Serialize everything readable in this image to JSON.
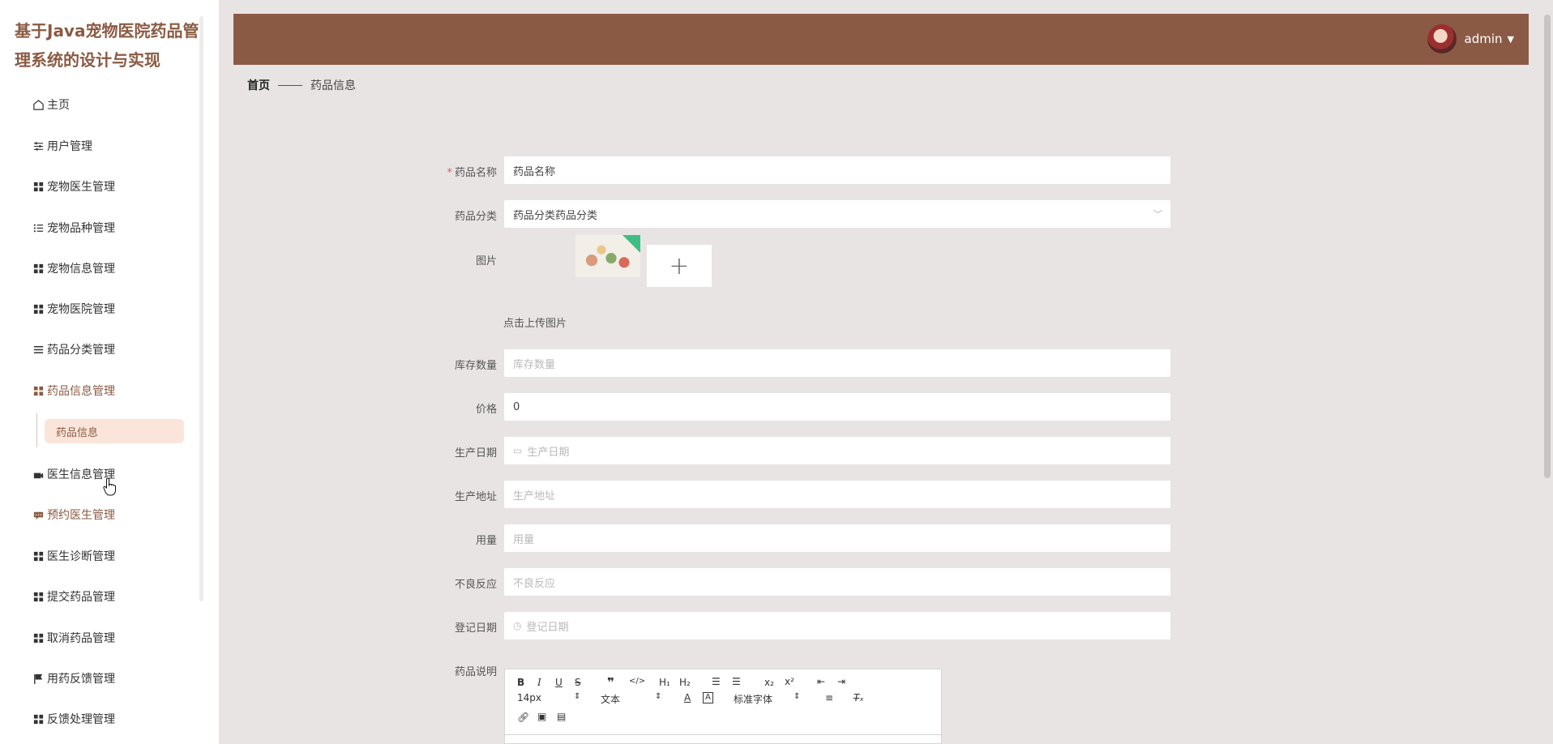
{
  "app": {
    "title": "基于Java宠物医院药品管理系统的设计与实现"
  },
  "sidebar": {
    "items": [
      {
        "label": "主页",
        "icon": "home-icon"
      },
      {
        "label": "用户管理",
        "icon": "sliders-icon"
      },
      {
        "label": "宠物医生管理",
        "icon": "grid-icon"
      },
      {
        "label": "宠物品种管理",
        "icon": "list-icon"
      },
      {
        "label": "宠物信息管理",
        "icon": "grid-icon"
      },
      {
        "label": "宠物医院管理",
        "icon": "grid-icon"
      },
      {
        "label": "药品分类管理",
        "icon": "menu-icon"
      },
      {
        "label": "药品信息管理",
        "icon": "grid-icon"
      },
      {
        "label": "医生信息管理",
        "icon": "camera-icon"
      },
      {
        "label": "预约医生管理",
        "icon": "message-icon"
      },
      {
        "label": "医生诊断管理",
        "icon": "grid-icon"
      },
      {
        "label": "提交药品管理",
        "icon": "grid-icon"
      },
      {
        "label": "取消药品管理",
        "icon": "grid-icon"
      },
      {
        "label": "用药反馈管理",
        "icon": "flag-icon"
      },
      {
        "label": "反馈处理管理",
        "icon": "grid-icon"
      }
    ],
    "active_sub": "药品信息"
  },
  "header": {
    "username": "admin"
  },
  "breadcrumb": {
    "home": "首页",
    "current": "药品信息"
  },
  "form": {
    "name": {
      "label": "药品名称",
      "value": "药品名称"
    },
    "category": {
      "label": "药品分类",
      "value": "药品分类药品分类"
    },
    "image": {
      "label": "图片",
      "upload_tip": "点击上传图片"
    },
    "stock": {
      "label": "库存数量",
      "placeholder": "库存数量"
    },
    "price": {
      "label": "价格",
      "value": "0"
    },
    "production_date": {
      "label": "生产日期",
      "placeholder": "生产日期"
    },
    "production_address": {
      "label": "生产地址",
      "placeholder": "生产地址"
    },
    "dosage": {
      "label": "用量",
      "placeholder": "用量"
    },
    "adverse_reaction": {
      "label": "不良反应",
      "placeholder": "不良反应"
    },
    "register_date": {
      "label": "登记日期",
      "placeholder": "登记日期"
    },
    "description": {
      "label": "药品说明"
    }
  },
  "editor": {
    "font_size": "14px",
    "text_type": "文本",
    "font_family": "标准字体"
  },
  "colors": {
    "brand": "#8b5a45",
    "active_bg": "#fbe5da",
    "page_bg": "#e9e4e4"
  }
}
